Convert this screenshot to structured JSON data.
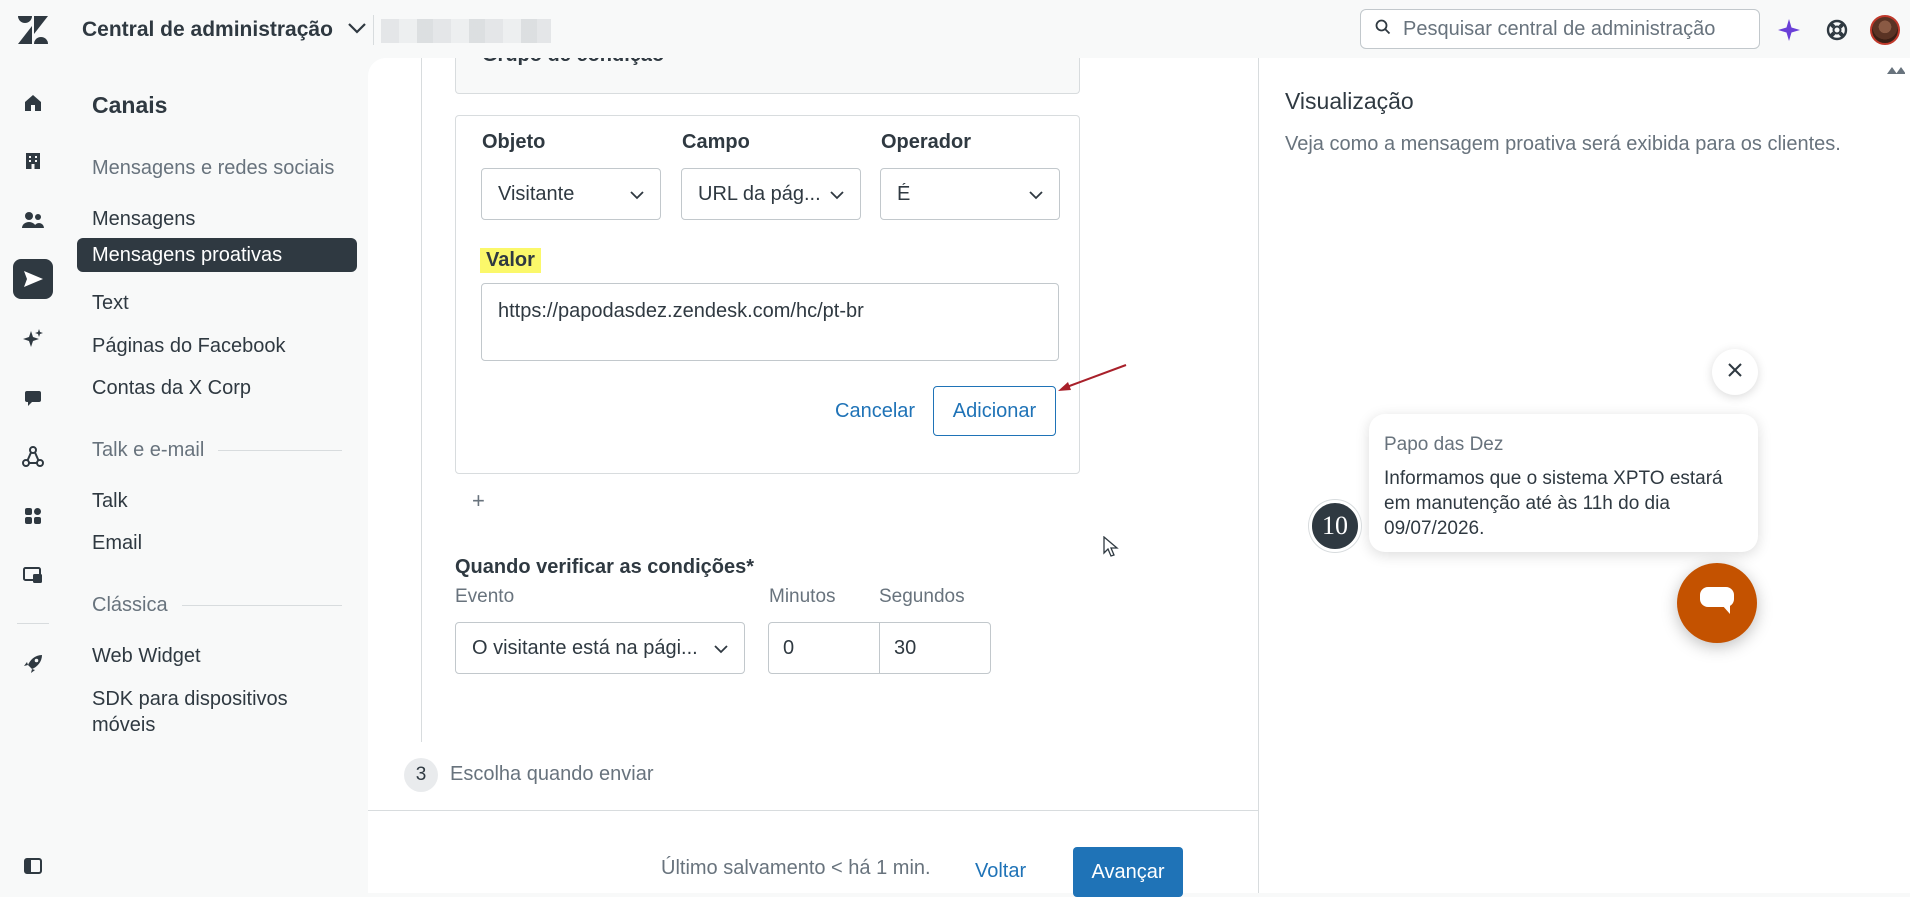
{
  "topbar": {
    "product_name": "Central de administração",
    "search_placeholder": "Pesquisar central de administração"
  },
  "secnav": {
    "title": "Canais",
    "groups": [
      {
        "label": "Mensagens e redes sociais"
      },
      {
        "label": "Talk e e-mail"
      },
      {
        "label": "Clássica"
      }
    ],
    "items": [
      {
        "label": "Mensagens"
      },
      {
        "label": "Mensagens proativas"
      },
      {
        "label": "Text"
      },
      {
        "label": "Páginas do Facebook"
      },
      {
        "label": "Contas da X Corp"
      },
      {
        "label": "Talk"
      },
      {
        "label": "Email"
      },
      {
        "label": "Web Widget"
      },
      {
        "label": "SDK para dispositivos móveis"
      }
    ]
  },
  "condition": {
    "prev_title": "Grupo de condição",
    "object_label": "Objeto",
    "object_value": "Visitante",
    "field_label": "Campo",
    "field_value": "URL da pág...",
    "operator_label": "Operador",
    "operator_value": "É",
    "value_label": "Valor",
    "value": "https://papodasdez.zendesk.com/hc/pt-br",
    "cancel_label": "Cancelar",
    "add_label": "Adicionar",
    "plus": "+"
  },
  "timing": {
    "title": "Quando verificar as condições*",
    "event_label": "Evento",
    "event_value": "O visitante está na pági...",
    "minutes_label": "Minutos",
    "minutes_value": "0",
    "seconds_label": "Segundos",
    "seconds_value": "30"
  },
  "step3": {
    "number": "3",
    "label": "Escolha quando enviar"
  },
  "footer": {
    "last_save": "Último salvamento < há 1 min.",
    "back_label": "Voltar",
    "next_label": "Avançar"
  },
  "preview": {
    "title": "Visualização",
    "description": "Veja como a mensagem proativa será exibida para os clientes.",
    "sender": "Papo das Dez",
    "message": "Informamos que o sistema XPTO estará em manutenção até às 11h do dia 09/07/2026.",
    "avatar_text": "10"
  },
  "colors": {
    "accent": "#1f73b7",
    "nav_active": "#2f3941",
    "launcher": "#c45200",
    "highlight": "#fbf86a",
    "annotation_arrow": "#a8202a"
  }
}
